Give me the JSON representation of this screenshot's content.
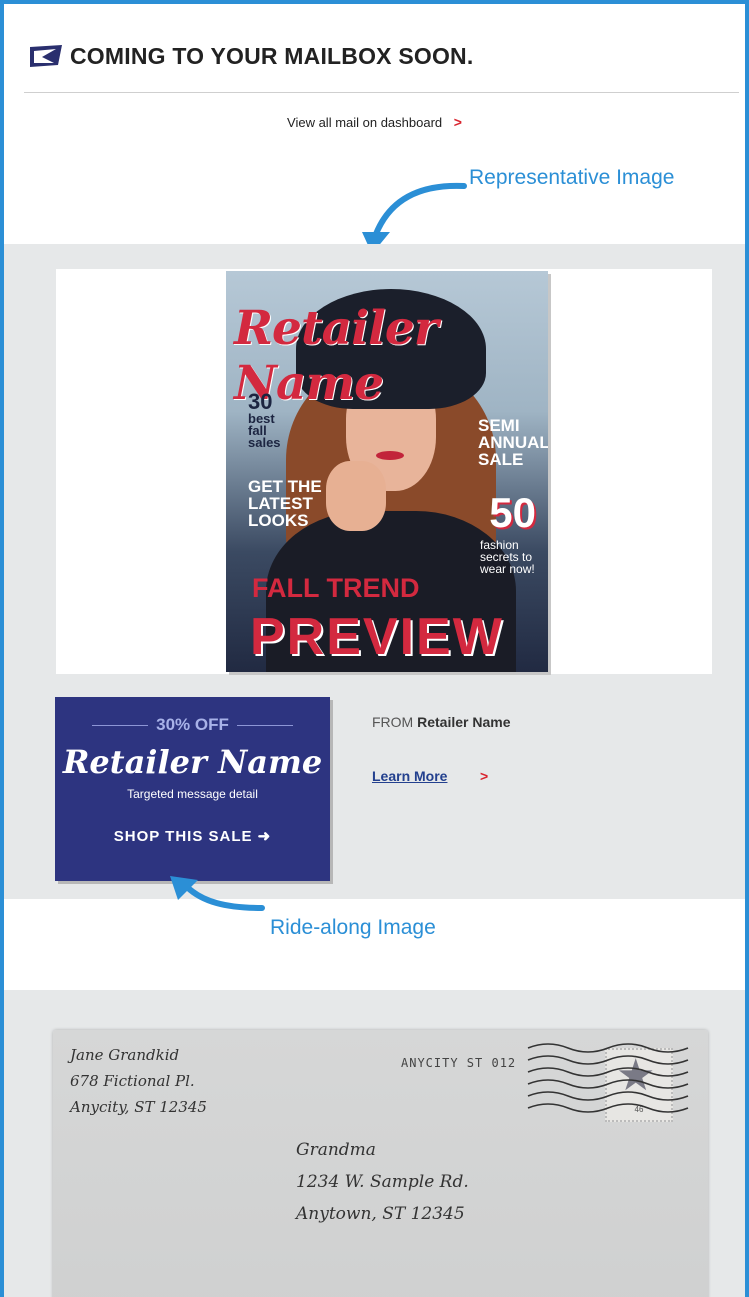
{
  "header": {
    "title": "COMING TO YOUR MAILBOX SOON."
  },
  "dashboard_link": {
    "label": "View all mail on dashboard",
    "chevron": ">"
  },
  "callouts": {
    "representative": "Representative Image",
    "ride_along": "Ride-along Image"
  },
  "magazine": {
    "masthead": "Retailer Name",
    "big_number": "30",
    "best_fall_sales": "best fall sales",
    "latest_looks": "GET THE LATEST LOOKS",
    "semi_annual": "SEMI ANNUAL SALE",
    "fifty": "50",
    "fashion_secrets": "fashion secrets to wear now!",
    "fall_trend": "FALL TREND",
    "preview": "PREVIEW"
  },
  "ride_along": {
    "discount": "30% OFF",
    "retailer": "Retailer Name",
    "detail": "Targeted message detail",
    "cta": "SHOP THIS SALE ➜"
  },
  "sender": {
    "from_label": "FROM",
    "name": "Retailer Name"
  },
  "learn_more": {
    "label": "Learn More",
    "chevron": ">"
  },
  "envelope": {
    "return_name": "Jane Grandkid",
    "return_street": "678 Fictional Pl.",
    "return_city": "Anycity, ST 12345",
    "postmark": "ANYCITY ST 012",
    "recipient_name": "Grandma",
    "recipient_street": "1234 W. Sample Rd.",
    "recipient_city": "Anytown, ST 12345",
    "stamp_value": "46"
  },
  "colors": {
    "accent": "#2b8fd6",
    "brand_blue": "#2d3480",
    "chevron_red": "#d9242e",
    "link_blue": "#23408e"
  }
}
